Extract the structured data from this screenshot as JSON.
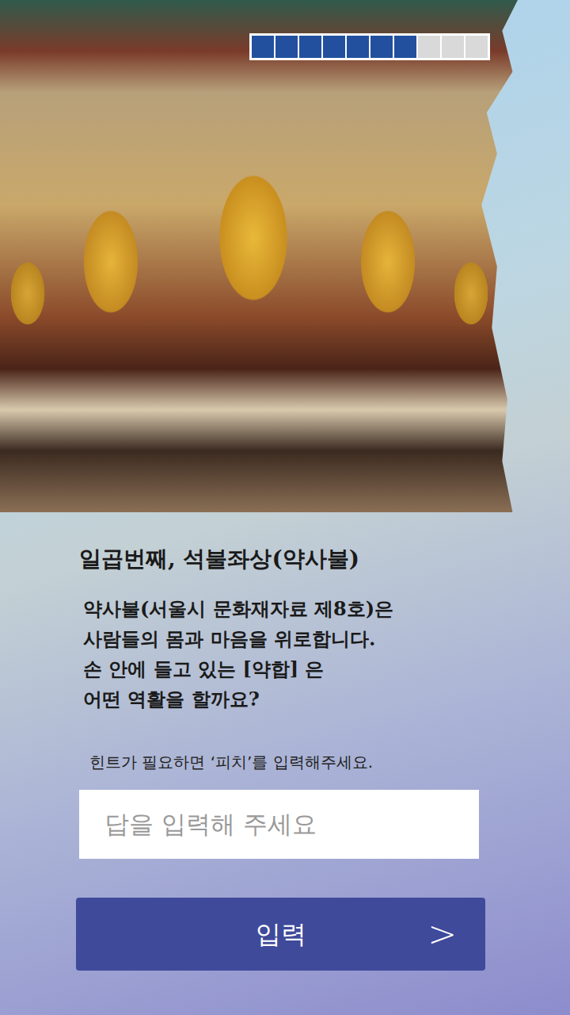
{
  "progress": {
    "steps": [
      {
        "done": true
      },
      {
        "done": true
      },
      {
        "done": true
      },
      {
        "done": true
      },
      {
        "done": true
      },
      {
        "done": true
      },
      {
        "done": true
      },
      {
        "done": false
      },
      {
        "done": false
      },
      {
        "done": false
      }
    ]
  },
  "quiz": {
    "title": "일곱번째, 석불좌상(약사불)",
    "question_lines": [
      "약사불(서울시 문화재자료 제8호)은",
      "사람들의 몸과 마음을 위로합니다.",
      "손 안에 들고 있는 [약합] 은",
      "어떤 역활을 할까요?"
    ],
    "hint": "힌트가 필요하면 ‘피치’를 입력해주세요."
  },
  "answer": {
    "placeholder": "답을 입력해 주세요"
  },
  "submit": {
    "label": "입력",
    "arrow": ">"
  }
}
